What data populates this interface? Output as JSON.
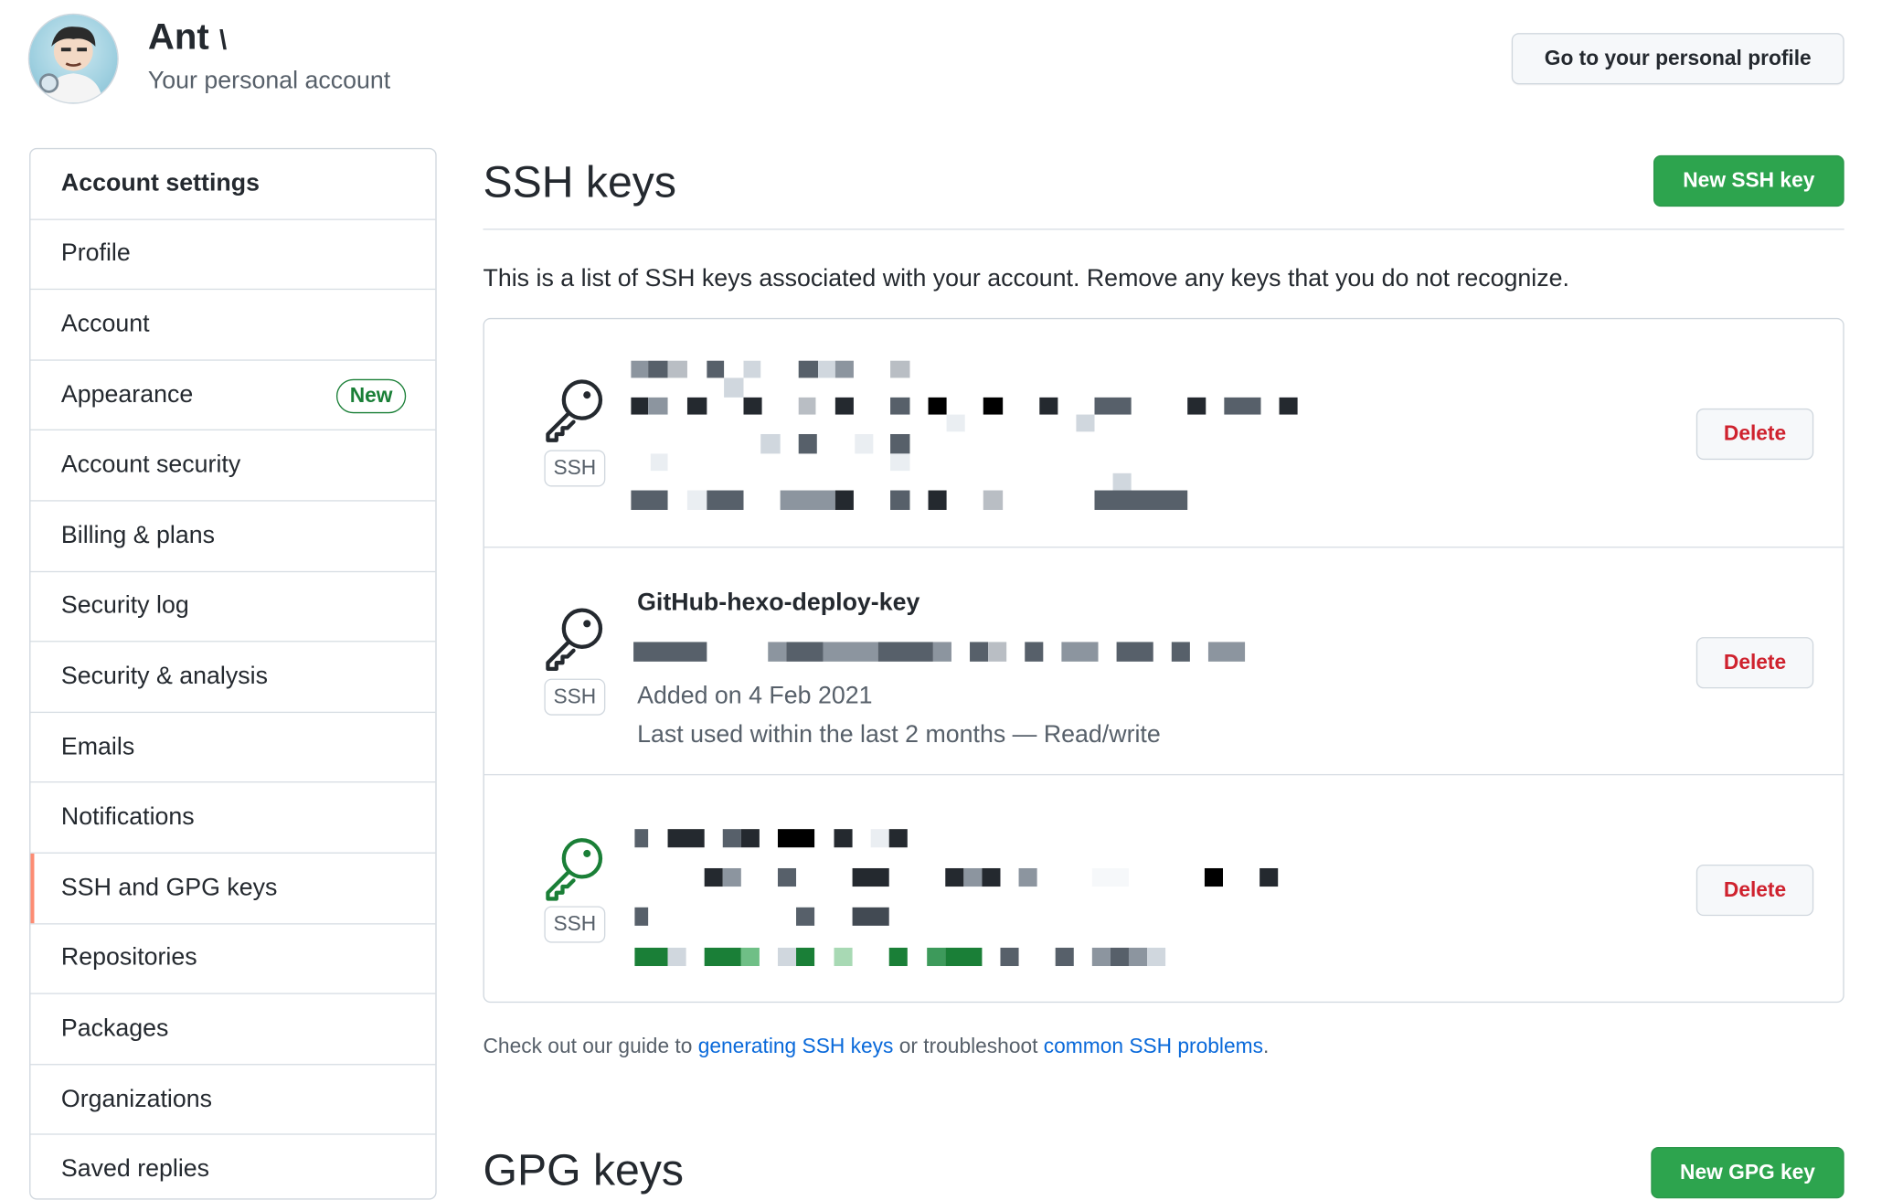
{
  "user": {
    "name": "Ant",
    "name_mark": "\\",
    "subtitle": "Your personal account",
    "profile_button": "Go to your personal profile"
  },
  "sidebar": {
    "header": "Account settings",
    "items": [
      {
        "label": "Profile"
      },
      {
        "label": "Account"
      },
      {
        "label": "Appearance",
        "badge": "New"
      },
      {
        "label": "Account security"
      },
      {
        "label": "Billing & plans"
      },
      {
        "label": "Security log"
      },
      {
        "label": "Security & analysis"
      },
      {
        "label": "Emails"
      },
      {
        "label": "Notifications"
      },
      {
        "label": "SSH and GPG keys",
        "active": true
      },
      {
        "label": "Repositories"
      },
      {
        "label": "Packages"
      },
      {
        "label": "Organizations"
      },
      {
        "label": "Saved replies"
      }
    ]
  },
  "ssh": {
    "title": "SSH keys",
    "new_button": "New SSH key",
    "intro": "This is a list of SSH keys associated with your account. Remove any keys that you do not recognize.",
    "keys": [
      {
        "type_label": "SSH",
        "delete_label": "Delete",
        "icon": "key-icon",
        "icon_color": "#24292f"
      },
      {
        "type_label": "SSH",
        "delete_label": "Delete",
        "icon": "key-icon",
        "icon_color": "#24292f",
        "title": "GitHub-hexo-deploy-key",
        "added": "Added on 4 Feb 2021",
        "last_used": "Last used within the last 2 months — Read/write"
      },
      {
        "type_label": "SSH",
        "delete_label": "Delete",
        "icon": "key-icon",
        "icon_color": "#1a7f37"
      }
    ],
    "guide": {
      "prefix": "Check out our guide to ",
      "link1": "generating SSH keys",
      "middle": " or troubleshoot ",
      "link2": "common SSH problems",
      "suffix": "."
    }
  },
  "gpg": {
    "title": "GPG keys",
    "new_button": "New GPG key"
  },
  "colors": {
    "primary_green": "#2da44e",
    "danger_red": "#cf222e",
    "link_blue": "#0969da",
    "active_marker": "#fd8c73"
  }
}
